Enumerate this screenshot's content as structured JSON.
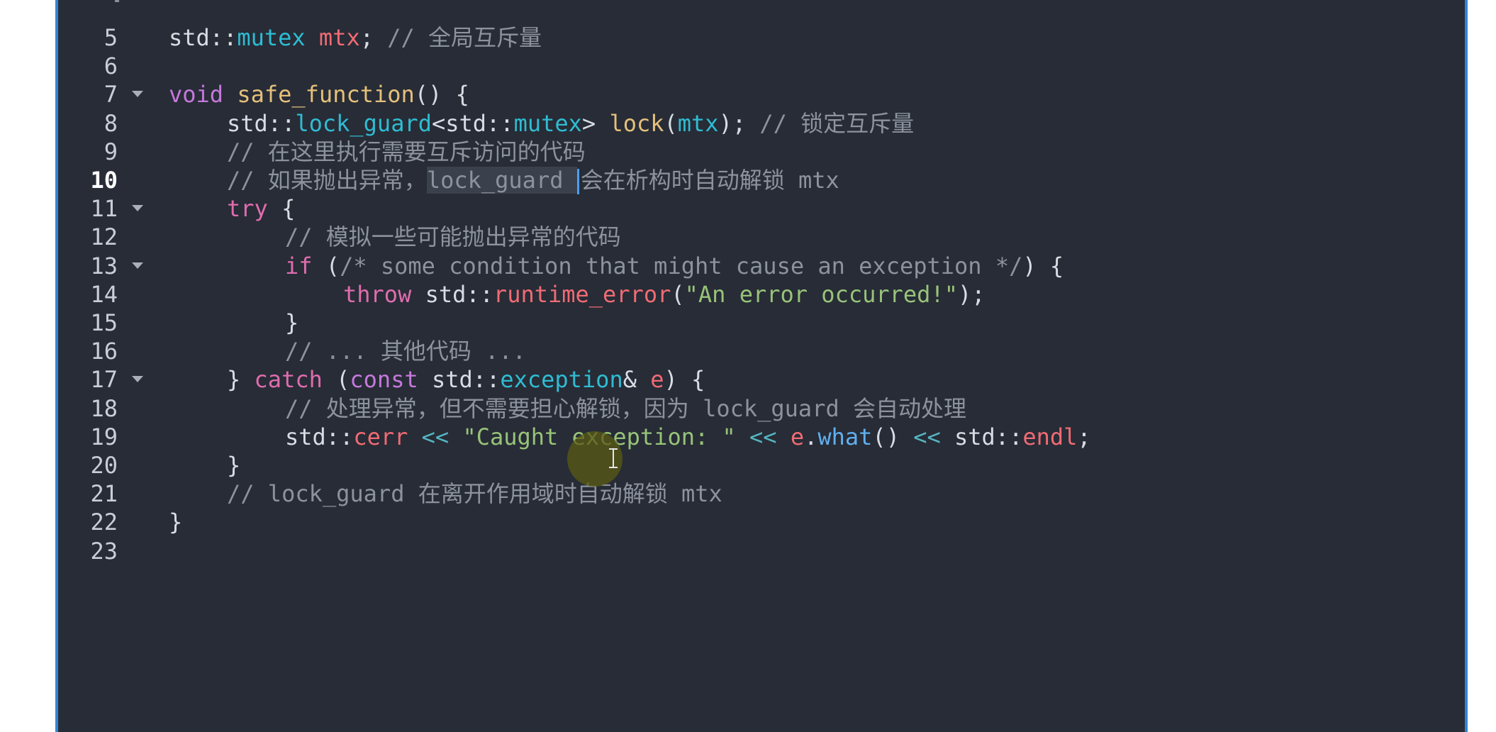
{
  "editor": {
    "active_line": "10",
    "lines": [
      {
        "n": "5",
        "fold": false,
        "indent": 0,
        "tokens": [
          [
            "t-plain",
            "std::"
          ],
          [
            "t-type",
            "mutex"
          ],
          [
            "t-plain",
            " "
          ],
          [
            "t-var",
            "mtx"
          ],
          [
            "t-plain",
            "; "
          ],
          [
            "t-cm",
            "// 全局互斥量"
          ]
        ]
      },
      {
        "n": "6",
        "fold": false,
        "indent": 0,
        "tokens": []
      },
      {
        "n": "7",
        "fold": true,
        "indent": 0,
        "tokens": [
          [
            "t-kw",
            "void"
          ],
          [
            "t-plain",
            " "
          ],
          [
            "t-fn",
            "safe_function"
          ],
          [
            "t-plain",
            "() {"
          ]
        ]
      },
      {
        "n": "8",
        "fold": false,
        "indent": 1,
        "tokens": [
          [
            "t-plain",
            "std::"
          ],
          [
            "t-type",
            "lock_guard"
          ],
          [
            "t-plain",
            "<std::"
          ],
          [
            "t-type",
            "mutex"
          ],
          [
            "t-plain",
            "> "
          ],
          [
            "t-fn",
            "lock"
          ],
          [
            "t-plain",
            "("
          ],
          [
            "t-type",
            "mtx"
          ],
          [
            "t-plain",
            "); "
          ],
          [
            "t-cm",
            "// 锁定互斥量"
          ]
        ]
      },
      {
        "n": "9",
        "fold": false,
        "indent": 1,
        "tokens": [
          [
            "t-cm",
            "// 在这里执行需要互斥访问的代码"
          ]
        ]
      },
      {
        "n": "10",
        "fold": false,
        "indent": 1,
        "tokens": [
          [
            "t-cm",
            "// 如果抛出异常，"
          ],
          [
            "t-cm sel",
            "lock_guard "
          ],
          [
            "caret",
            ""
          ],
          [
            "t-cm",
            "会在析构时自动解锁 mtx"
          ]
        ]
      },
      {
        "n": "11",
        "fold": true,
        "indent": 1,
        "tokens": [
          [
            "t-kw2",
            "try"
          ],
          [
            "t-plain",
            " {"
          ]
        ]
      },
      {
        "n": "12",
        "fold": false,
        "indent": 2,
        "tokens": [
          [
            "t-cm",
            "// 模拟一些可能抛出异常的代码"
          ]
        ]
      },
      {
        "n": "13",
        "fold": true,
        "indent": 2,
        "tokens": [
          [
            "t-kw2",
            "if"
          ],
          [
            "t-plain",
            " ("
          ],
          [
            "t-cm",
            "/* some condition that might cause an exception */"
          ],
          [
            "t-plain",
            ") {"
          ]
        ]
      },
      {
        "n": "14",
        "fold": false,
        "indent": 3,
        "tokens": [
          [
            "t-kw2",
            "throw"
          ],
          [
            "t-plain",
            " std::"
          ],
          [
            "t-var",
            "runtime_error"
          ],
          [
            "t-plain",
            "("
          ],
          [
            "t-str",
            "\"An error occurred!\""
          ],
          [
            "t-plain",
            ");"
          ]
        ]
      },
      {
        "n": "15",
        "fold": false,
        "indent": 2,
        "tokens": [
          [
            "t-plain",
            "}"
          ]
        ]
      },
      {
        "n": "16",
        "fold": false,
        "indent": 2,
        "tokens": [
          [
            "t-cm",
            "// ... 其他代码 ..."
          ]
        ]
      },
      {
        "n": "17",
        "fold": true,
        "indent": 1,
        "tokens": [
          [
            "t-plain",
            "} "
          ],
          [
            "t-kw2",
            "catch"
          ],
          [
            "t-plain",
            " ("
          ],
          [
            "t-kw",
            "const"
          ],
          [
            "t-plain",
            " std::"
          ],
          [
            "t-type",
            "exception"
          ],
          [
            "t-plain",
            "& "
          ],
          [
            "t-var",
            "e"
          ],
          [
            "t-plain",
            ") {"
          ]
        ]
      },
      {
        "n": "18",
        "fold": false,
        "indent": 2,
        "tokens": [
          [
            "t-cm",
            "// 处理异常，但不需要担心解锁，因为 lock_guard 会自动处理"
          ]
        ]
      },
      {
        "n": "19",
        "fold": false,
        "indent": 2,
        "tokens": [
          [
            "t-plain",
            "std::"
          ],
          [
            "t-var",
            "cerr"
          ],
          [
            "t-plain",
            " "
          ],
          [
            "t-op",
            "<<"
          ],
          [
            "t-plain",
            " "
          ],
          [
            "t-str",
            "\"Caught exception: \""
          ],
          [
            "t-plain",
            " "
          ],
          [
            "t-op",
            "<<"
          ],
          [
            "t-plain",
            " "
          ],
          [
            "t-var",
            "e"
          ],
          [
            "t-plain",
            "."
          ],
          [
            "t-fnblue",
            "what"
          ],
          [
            "t-plain",
            "() "
          ],
          [
            "t-op",
            "<<"
          ],
          [
            "t-plain",
            " std::"
          ],
          [
            "t-var",
            "endl"
          ],
          [
            "t-plain",
            ";"
          ]
        ]
      },
      {
        "n": "20",
        "fold": false,
        "indent": 1,
        "tokens": [
          [
            "t-plain",
            "}"
          ]
        ]
      },
      {
        "n": "21",
        "fold": false,
        "indent": 1,
        "tokens": [
          [
            "t-cm",
            "// lock_guard 在离开作用域时自动解锁 mtx"
          ]
        ]
      },
      {
        "n": "22",
        "fold": false,
        "indent": 0,
        "tokens": [
          [
            "t-plain",
            "}"
          ]
        ]
      },
      {
        "n": "23",
        "fold": false,
        "indent": 0,
        "tokens": []
      }
    ]
  },
  "colors": {
    "editor_bg": "#272c36",
    "border_accent": "#2f86d6",
    "comment": "#8c929e",
    "keyword": "#c678dd",
    "type": "#2fbcd3",
    "variable": "#f06b74",
    "function": "#e5c07b",
    "string": "#98c379"
  },
  "cursor": {
    "icon": "text-ibeam-icon"
  }
}
